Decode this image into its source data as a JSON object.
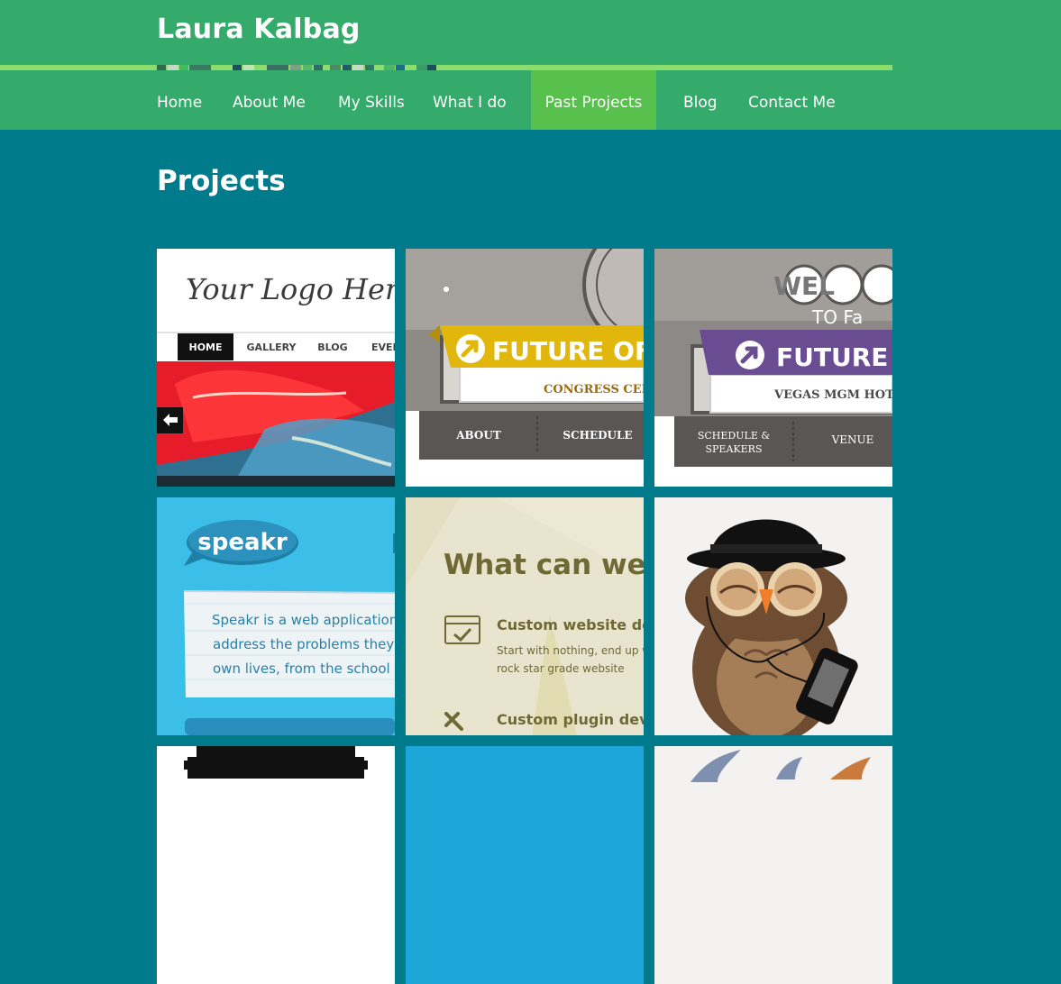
{
  "site": {
    "title": "Laura Kalbag"
  },
  "nav": {
    "items": [
      {
        "label": "Home"
      },
      {
        "label": "About Me"
      },
      {
        "label": "My Skills"
      },
      {
        "label": "What I do"
      },
      {
        "label": "Past Projects",
        "active": true
      },
      {
        "label": "Blog"
      },
      {
        "label": "Contact Me"
      }
    ]
  },
  "page": {
    "title": "Projects"
  },
  "colors": {
    "header": "#34aa6b",
    "nav_active": "#58c04c",
    "background": "#007b8c",
    "stripe": "#8bde6b"
  },
  "projects": [
    {
      "logo_text": "Your Logo Here",
      "menu": [
        "HOME",
        "GALLERY",
        "BLOG",
        "EVEN"
      ],
      "arrow_icon": "arrow-left-icon"
    },
    {
      "banner": "FUTURE OF WE",
      "venue": "CONGRESS CENTR",
      "menu": [
        "ABOUT",
        "SCHEDULE"
      ]
    },
    {
      "sign": "WEL",
      "sign_sub": "TO Fa",
      "banner": "FUTURE IN",
      "venue": "VEGAS MGM HOTEL",
      "menu_line1": "SCHEDULE &",
      "menu_line2": "SPEAKERS",
      "menu_item2": "VENUE"
    },
    {
      "logo": "speakr",
      "line1": "Speakr is a web application",
      "line2": "address the problems they f",
      "line3": "own lives, from the school e"
    },
    {
      "heading": "What can we do",
      "item1_title": "Custom website develo",
      "item1_text1": "Start with nothing, end up wi",
      "item1_text2": "rock star grade website",
      "item2_title": "Custom plugin develop"
    },
    {
      "illustration": "owl-with-bowler-hat"
    },
    {
      "illustration": "black-device"
    },
    {
      "illustration": "blue-tile"
    },
    {
      "illustration": "animal-ears"
    }
  ]
}
